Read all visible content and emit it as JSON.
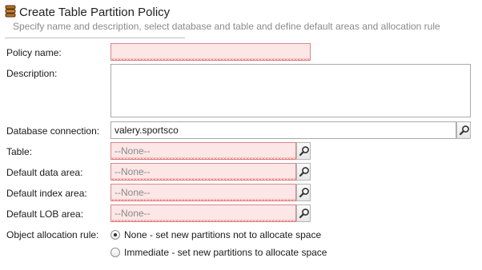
{
  "header": {
    "icon": "database-stack-icon",
    "title": "Create Table Partition Policy",
    "subtitle": "Specify name and description, select database and table and define default areas and allocation rule"
  },
  "form": {
    "policy_name": {
      "label": "Policy name:",
      "value": ""
    },
    "description": {
      "label": "Description:",
      "value": ""
    },
    "database_connection": {
      "label": "Database connection:",
      "value": "valery.sportsco"
    },
    "table": {
      "label": "Table:",
      "value": "--None--"
    },
    "default_data_area": {
      "label": "Default data area:",
      "value": "--None--"
    },
    "default_index_area": {
      "label": "Default index area:",
      "value": "--None--"
    },
    "default_lob_area": {
      "label": "Default LOB area:",
      "value": "--None--"
    },
    "allocation_rule": {
      "label": "Object allocation rule:",
      "options": [
        {
          "label": "None - set new partitions not to allocate space",
          "selected": true
        },
        {
          "label": "Immediate - set new partitions to allocate space",
          "selected": false
        }
      ]
    }
  },
  "colors": {
    "invalid_background": "#fde6e6",
    "invalid_border": "#d9888a",
    "squiggle": "#e34b4b",
    "subtitle": "#8a8a8a"
  }
}
